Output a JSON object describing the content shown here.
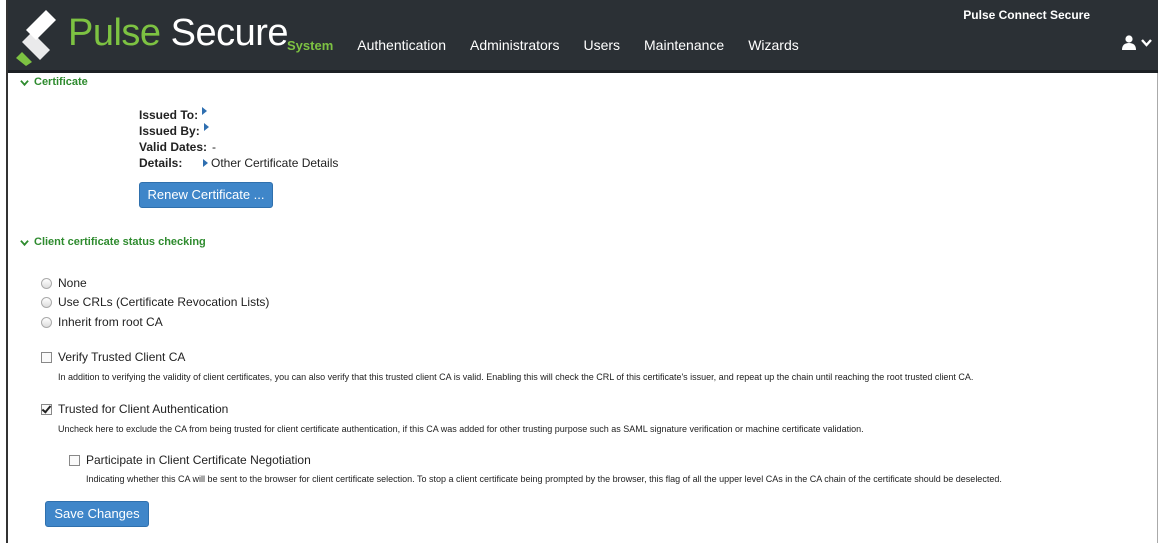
{
  "header": {
    "brand_part1": "Pulse",
    "brand_part2": "Secure",
    "product_name": "Pulse Connect Secure",
    "nav": [
      {
        "label": "System",
        "active": true
      },
      {
        "label": "Authentication"
      },
      {
        "label": "Administrators"
      },
      {
        "label": "Users"
      },
      {
        "label": "Maintenance"
      },
      {
        "label": "Wizards"
      }
    ],
    "icons": {
      "logo": "pulse-logo",
      "user": "user-icon",
      "dropdown": "chevron-down-icon"
    }
  },
  "certificate": {
    "heading": "Certificate",
    "issued_to_label": "Issued To:",
    "issued_by_label": "Issued By:",
    "valid_dates_label": "Valid Dates:",
    "valid_dates_value": "-",
    "details_label": "Details:",
    "details_link": "Other Certificate Details",
    "renew_button": "Renew Certificate ..."
  },
  "status_checking": {
    "heading": "Client certificate status checking",
    "radios": [
      {
        "label": "None"
      },
      {
        "label": "Use CRLs (Certificate Revocation Lists)"
      },
      {
        "label": "Inherit from root CA"
      }
    ],
    "verify_ca": {
      "label": "Verify Trusted Client CA",
      "checked": false,
      "description": "In addition to verifying the validity of client certificates, you can also verify that this trusted client CA is valid. Enabling this will check the CRL of this certificate's issuer, and repeat up the chain until reaching the root trusted client CA."
    },
    "trusted_auth": {
      "label": "Trusted for Client Authentication",
      "checked": true,
      "description": "Uncheck here to exclude the CA from being trusted for client certificate authentication, if this CA was added for other trusting purpose such as SAML signature verification or machine certificate validation."
    },
    "participate": {
      "label": "Participate in Client Certificate Negotiation",
      "checked": false,
      "description": "Indicating whether this CA will be sent to the browser for client certificate selection. To stop a client certificate being prompted by the browser, this flag of all the upper level CAs in the CA chain of the certificate should be deselected."
    }
  },
  "save_button": "Save Changes",
  "colors": {
    "topbar": "#2b3035",
    "accent_green": "#7dc242",
    "button_blue": "#3f86c9",
    "section_green": "#2e8b2e"
  }
}
